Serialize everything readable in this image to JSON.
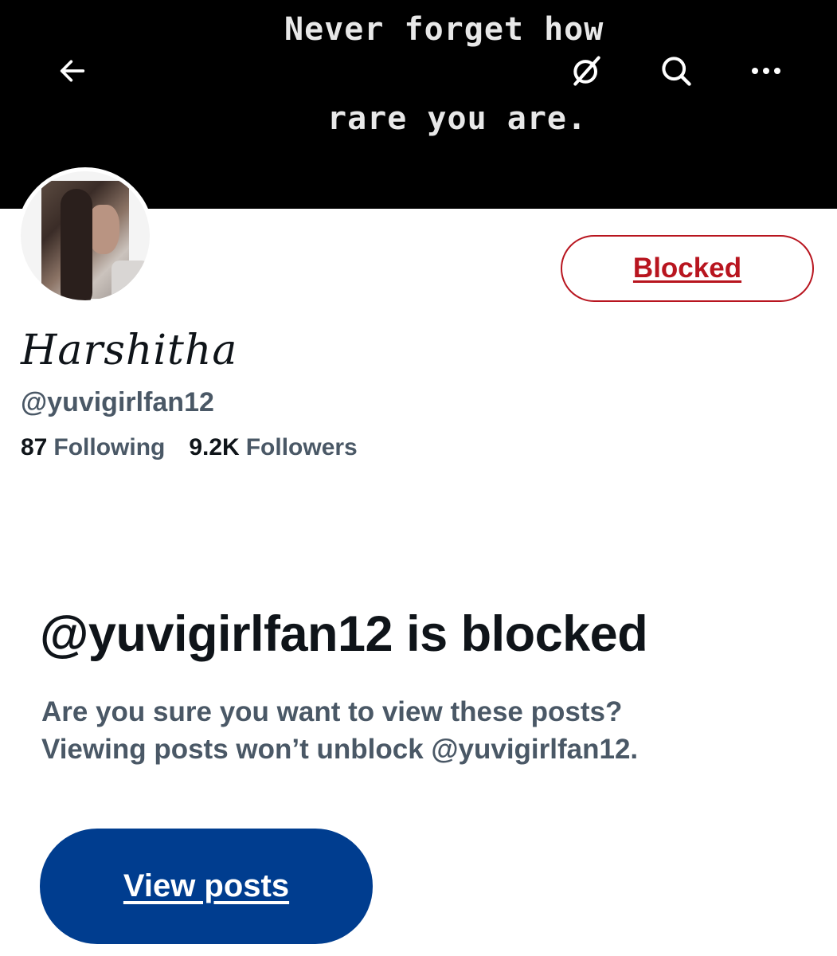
{
  "banner": {
    "line1": "Never forget how",
    "line2": "rare you are."
  },
  "header_icons": {
    "back": "arrow-left-icon",
    "grok": "grok-icon",
    "search": "search-icon",
    "more": "more-icon"
  },
  "profile": {
    "display_name": "Harshitha",
    "handle": "@yuvigirlfan12",
    "following_count": "87",
    "following_label": "Following",
    "followers_count": "9.2K",
    "followers_label": "Followers",
    "block_button_label": "Blocked"
  },
  "blocked_notice": {
    "title": "@yuvigirlfan12 is blocked",
    "line1": "Are you sure you want to view these posts?",
    "line2": "Viewing posts won’t unblock @yuvigirlfan12.",
    "button_label": "View posts"
  },
  "colors": {
    "blocked_red": "#b8151f",
    "primary_button": "#003d8f",
    "secondary_text": "#4a5866",
    "primary_text": "#0f1419"
  }
}
